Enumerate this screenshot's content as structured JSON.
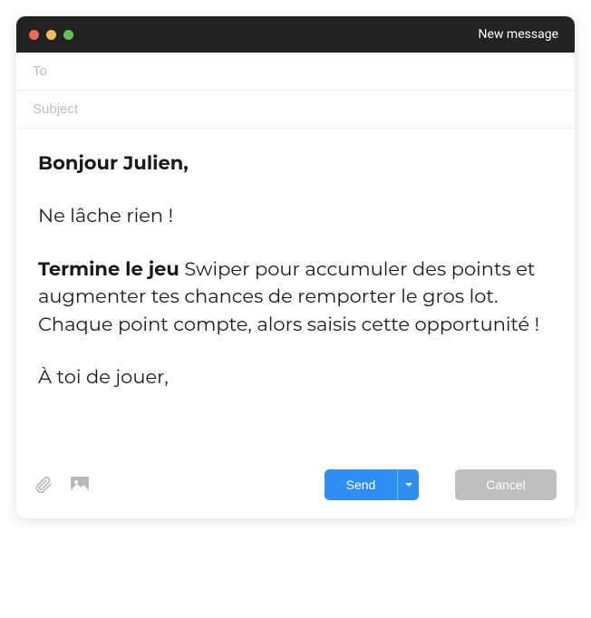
{
  "window": {
    "title": "New message"
  },
  "fields": {
    "to": {
      "placeholder": "To",
      "value": ""
    },
    "subject": {
      "placeholder": "Subject",
      "value": ""
    }
  },
  "body": {
    "greeting": "Bonjour Julien,",
    "line1": "Ne lâche rien !",
    "bold_run": "Termine le jeu",
    "line2_rest": " Swiper pour accumuler des points et augmenter tes chances de remporter le gros lot.",
    "line3": "Chaque point compte, alors saisis cette opportunité !",
    "signoff": "À toi de jouer,"
  },
  "toolbar": {
    "attach_icon": "paperclip-icon",
    "image_icon": "image-icon",
    "send_label": "Send",
    "cancel_label": "Cancel"
  }
}
